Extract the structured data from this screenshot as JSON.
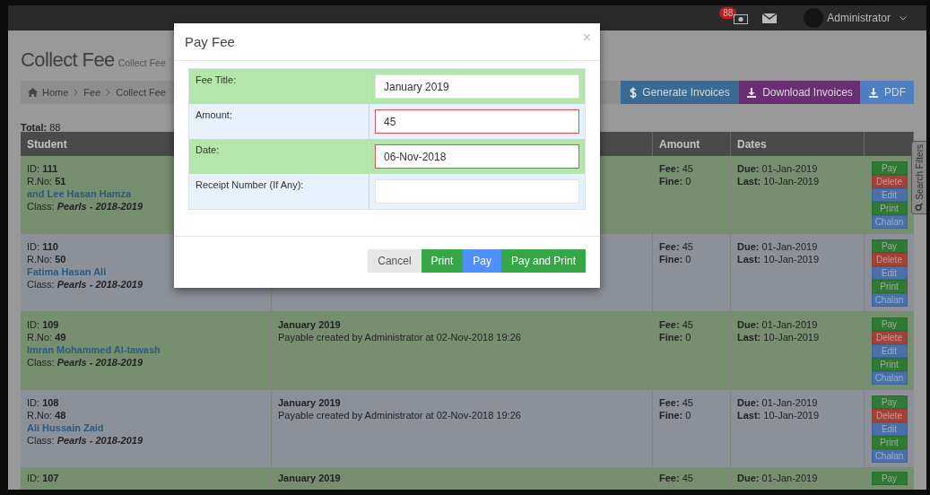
{
  "topbar": {
    "notification_count": "88",
    "user": "Administrator"
  },
  "page": {
    "title": "Collect Fee",
    "subtitle": "Collect Fee"
  },
  "breadcrumb": [
    "Home",
    "Fee",
    "Collect Fee"
  ],
  "toolbar": [
    {
      "label": "Generate Invoices",
      "kind": "generate"
    },
    {
      "label": "Download Invoices",
      "kind": "download"
    },
    {
      "label": "PDF",
      "kind": "pdf"
    }
  ],
  "total": "**Total:** 88",
  "search_filters": "Search Filters",
  "table": {
    "columns": [
      "Student",
      "Amount",
      "Dates"
    ],
    "rows": [
      {
        "paid": true,
        "id": "ID: **111**",
        "roll": "R.No: **51**",
        "name": "and Lee Hasan Hamza",
        "class_label": "Class:",
        "class": "Pearls - 2018-2019",
        "fee": "**Fee:** 45",
        "fine": "**Fine:** 0",
        "due": "**Due:** 01-Jan-2019",
        "last": "**Last:** 10-Jan-2019",
        "actions": [
          {
            "label": "Pay",
            "kind": "success"
          },
          {
            "label": "Delete",
            "kind": "danger"
          },
          {
            "label": "Edit",
            "kind": "primary"
          },
          {
            "label": "Print",
            "kind": "success"
          },
          {
            "label": "Chalan",
            "kind": "primary"
          }
        ]
      },
      {
        "paid": false,
        "id": "ID: **110**",
        "roll": "R.No: **50**",
        "name": "Fatima Hasan Ali",
        "class_label": "Class:",
        "class": "Pearls - 2018-2019",
        "fee": "**Fee:** 45",
        "fine": "**Fine:** 0",
        "due": "**Due:** 01-Jan-2019",
        "last": "**Last:** 10-Jan-2019",
        "actions": [
          {
            "label": "Pay",
            "kind": "success"
          },
          {
            "label": "Delete",
            "kind": "danger"
          },
          {
            "label": "Edit",
            "kind": "primary"
          },
          {
            "label": "Print",
            "kind": "success"
          },
          {
            "label": "Chalan",
            "kind": "primary"
          }
        ]
      },
      {
        "paid": true,
        "id": "ID: **109**",
        "roll": "R.No: **49**",
        "name": "Imran Mohammed Al-tawash",
        "class_label": "Class:",
        "class": "Pearls - 2018-2019",
        "title": "January 2019",
        "note": "Payable created by Administrator at 02-Nov-2018 19:26",
        "fee": "**Fee:** 45",
        "fine": "**Fine:** 0",
        "due": "**Due:** 01-Jan-2019",
        "last": "**Last:** 10-Jan-2019",
        "actions": [
          {
            "label": "Pay",
            "kind": "success"
          },
          {
            "label": "Delete",
            "kind": "danger"
          },
          {
            "label": "Edit",
            "kind": "primary"
          },
          {
            "label": "Print",
            "kind": "success"
          },
          {
            "label": "Chalan",
            "kind": "primary"
          }
        ]
      },
      {
        "paid": false,
        "id": "ID: **108**",
        "roll": "R.No: **48**",
        "name": "Ali Hussain Zaid",
        "class_label": "Class:",
        "class": "Pearls - 2018-2019",
        "title": "January 2019",
        "note": "Payable created by Administrator at 02-Nov-2018 19:26",
        "fee": "**Fee:** 45",
        "fine": "**Fine:** 0",
        "due": "**Due:** 01-Jan-2019",
        "last": "**Last:** 10-Jan-2019",
        "actions": [
          {
            "label": "Pay",
            "kind": "success"
          },
          {
            "label": "Delete",
            "kind": "danger"
          },
          {
            "label": "Edit",
            "kind": "primary"
          },
          {
            "label": "Print",
            "kind": "success"
          },
          {
            "label": "Chalan",
            "kind": "primary"
          }
        ]
      },
      {
        "paid": true,
        "id": "ID: **107**",
        "title": "January 2019",
        "fee": "**Fee:** 45",
        "due": "**Due:** 01-Jan-2019",
        "actions": [
          {
            "label": "Pay",
            "kind": "success"
          }
        ]
      }
    ]
  },
  "modal": {
    "title": "Pay Fee",
    "close": "×",
    "fields": [
      {
        "label": "Fee Title:",
        "value": "January 2019",
        "invalid": false
      },
      {
        "label": "Amount:",
        "value": "45",
        "invalid": true
      },
      {
        "label": "Date:",
        "value": "06-Nov-2018",
        "invalid": true
      },
      {
        "label": "Receipt Number (If Any):",
        "invalid": false
      }
    ],
    "buttons": [
      {
        "label": "Cancel",
        "kind": "default"
      },
      {
        "label": "Print",
        "kind": "success"
      },
      {
        "label": "Pay",
        "kind": "primary"
      },
      {
        "label": "Pay and Print",
        "kind": "success"
      }
    ]
  }
}
